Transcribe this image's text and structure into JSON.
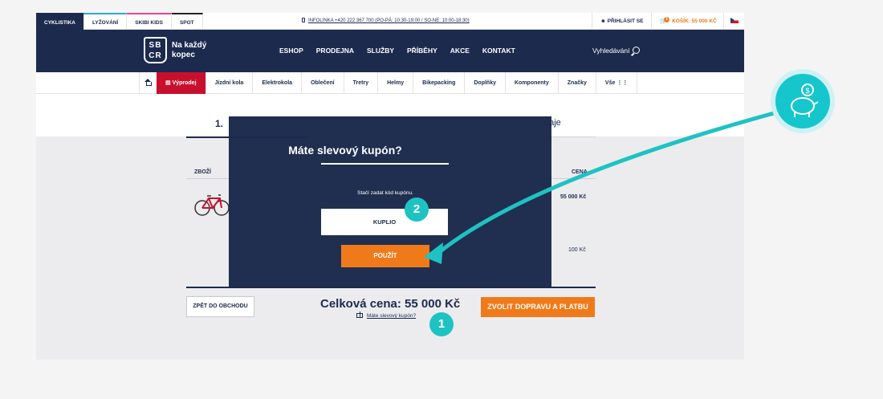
{
  "topbar": {
    "tabs": [
      "CYKLISTIKA",
      "LYŽOVÁNÍ",
      "SKIBI KIDS",
      "SPOT"
    ],
    "hotline": "INFOLINKA +420 222 367 700 (PO-PÁ: 10:30-19:00 / SO-NE: 10:00-18:30)",
    "login": "PŘIHLÁSIT SE",
    "cart_label": "KOŠÍK: 55 000 KČ",
    "cart_count": "1"
  },
  "header": {
    "logo_letters": [
      "SB",
      "CR"
    ],
    "logo_text_1": "Na každý",
    "logo_text_2": "kopec",
    "nav": [
      "ESHOP",
      "PRODEJNA",
      "SLUŽBY",
      "PŘÍBĚHY",
      "AKCE",
      "KONTAKT"
    ],
    "search": "Vyhledávání"
  },
  "categories": [
    "Výprodej",
    "Jízdní kola",
    "Elektrokola",
    "Oblečení",
    "Tretry",
    "Helmy",
    "Bikepacking",
    "Doplňky",
    "Komponenty",
    "Značky",
    "Vše"
  ],
  "page": {
    "step1": "1.",
    "step4": "daje",
    "col_goods": "ZBOŽÍ",
    "col_price": "CENA",
    "price1": "55 000 Kč",
    "price2": "100 Kč",
    "back": "ZPĚT DO OBCHODU",
    "total": "Celková cena: 55 000 Kč",
    "coupon_link": "Máte slevový kupón?",
    "order": "ZVOLIT DOPRAVU A PLATBU"
  },
  "modal": {
    "title": "Máte slevový kupón?",
    "hint": "Stačí zadat kód kupónu.",
    "code": "KUPLIO",
    "apply": "POUŽÍT"
  },
  "markers": [
    "1",
    "2"
  ],
  "colors": {
    "navy": "#1c2a4d",
    "orange": "#f07a1a",
    "sale": "#c8102e",
    "teal": "#1fc2c2"
  }
}
